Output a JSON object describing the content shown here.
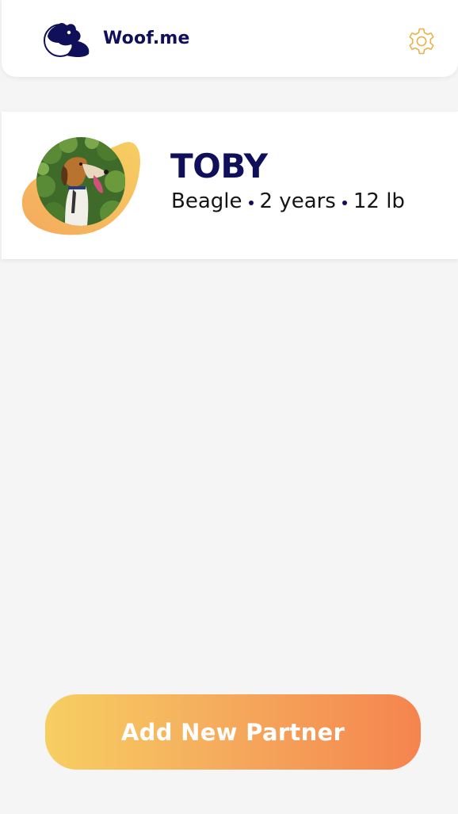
{
  "app": {
    "brand_name": "Woof.me",
    "logo_icon": "dog-logo-icon",
    "settings_icon": "gear-icon"
  },
  "pet": {
    "name": "TOBY",
    "breed": "Beagle",
    "age": "2 years",
    "weight": "12 lb",
    "photo_icon": "dog-photo"
  },
  "actions": {
    "add_partner_label": "Add New Partner"
  },
  "colors": {
    "brand_navy": "#10105a",
    "accent_yellow": "#f6cf62",
    "accent_orange": "#f5844e",
    "gear_stroke": "#e9b04a",
    "background": "#f5f5f5"
  }
}
